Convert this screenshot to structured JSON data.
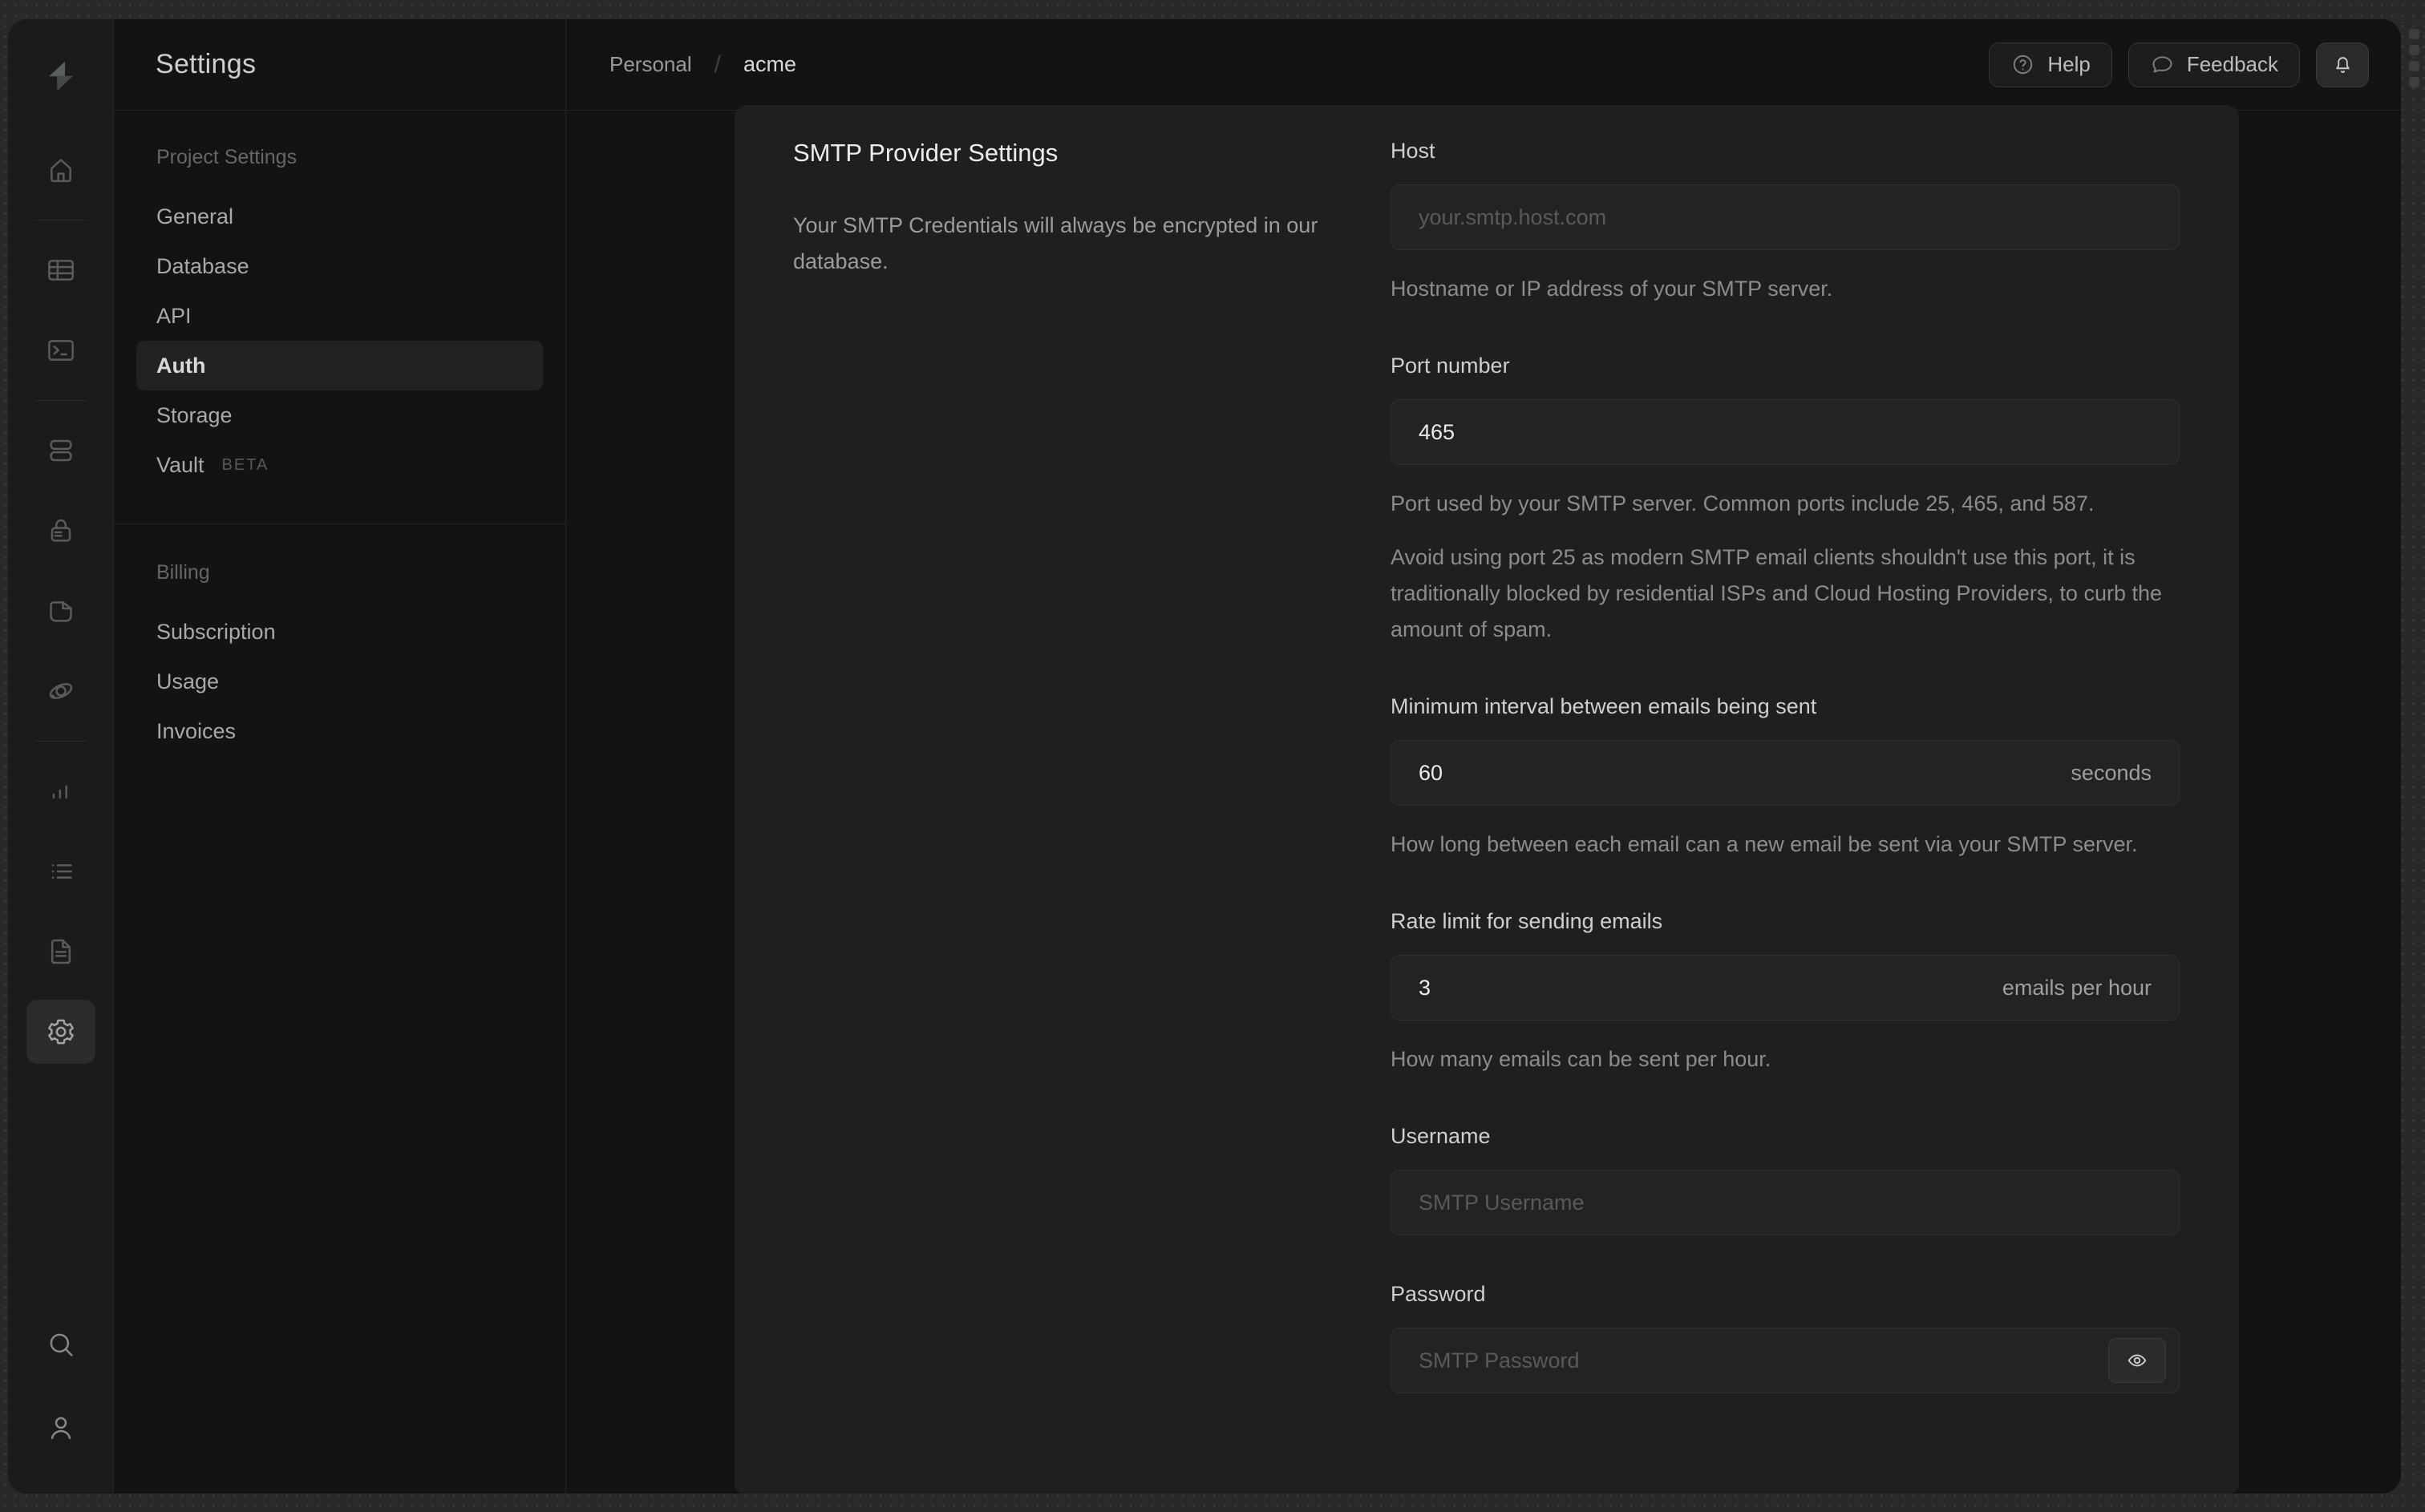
{
  "header": {
    "breadcrumb": {
      "org": "Personal",
      "sep": "/",
      "project": "acme"
    },
    "help_label": "Help",
    "feedback_label": "Feedback",
    "icons": {
      "help": "help-circle-icon",
      "feedback": "speech-bubble-icon",
      "notifications": "bell-icon"
    }
  },
  "rail": {
    "logo_icon": "supabase-logo",
    "groups": [
      [
        "home"
      ],
      [
        "table-editor",
        "sql-editor"
      ],
      [
        "database",
        "auth",
        "storage",
        "realtime"
      ],
      [
        "reports",
        "logs",
        "docs",
        "settings"
      ]
    ],
    "active": "settings",
    "bottom": [
      "search",
      "user"
    ]
  },
  "sidebar": {
    "title": "Settings",
    "sections": [
      {
        "heading": "Project Settings",
        "items": [
          {
            "label": "General"
          },
          {
            "label": "Database"
          },
          {
            "label": "API"
          },
          {
            "label": "Auth",
            "active": true
          },
          {
            "label": "Storage"
          },
          {
            "label": "Vault",
            "badge": "BETA"
          }
        ]
      },
      {
        "heading": "Billing",
        "items": [
          {
            "label": "Subscription"
          },
          {
            "label": "Usage"
          },
          {
            "label": "Invoices"
          }
        ]
      }
    ]
  },
  "panel": {
    "title": "SMTP Provider Settings",
    "description": "Your SMTP Credentials will always be encrypted in our database."
  },
  "form": {
    "fields": [
      {
        "id": "host",
        "label": "Host",
        "placeholder": "your.smtp.host.com",
        "helpers": [
          "Hostname or IP address of your SMTP server."
        ]
      },
      {
        "id": "port",
        "label": "Port number",
        "value": "465",
        "helpers": [
          "Port used by your SMTP server. Common ports include 25, 465, and 587.",
          "Avoid using port 25 as modern SMTP email clients shouldn't use this port, it is traditionally blocked by residential ISPs and Cloud Hosting Providers, to curb the amount of spam."
        ]
      },
      {
        "id": "minimum-interval",
        "label": "Minimum interval between emails being sent",
        "value": "60",
        "suffix": "seconds",
        "helpers": [
          "How long between each email can a new email be sent via your SMTP server."
        ]
      },
      {
        "id": "rate-limit",
        "label": "Rate limit for sending emails",
        "value": "3",
        "suffix": "emails per hour",
        "helpers": [
          "How many emails can be sent per hour."
        ]
      },
      {
        "id": "username",
        "label": "Username",
        "placeholder": "SMTP Username",
        "helpers": []
      },
      {
        "id": "password",
        "label": "Password",
        "type": "password",
        "placeholder": "SMTP Password",
        "reveal_button": "eye-icon",
        "helpers": []
      }
    ]
  },
  "colors": {
    "backdrop": "#292929",
    "window_bg": "#131313",
    "rail_bg": "#1b1b1b",
    "panel_bg": "#1f1f1f",
    "input_bg": "#232323",
    "active_item_bg": "#222222",
    "text_primary": "#ececec",
    "text_muted": "#8c8c8c"
  }
}
